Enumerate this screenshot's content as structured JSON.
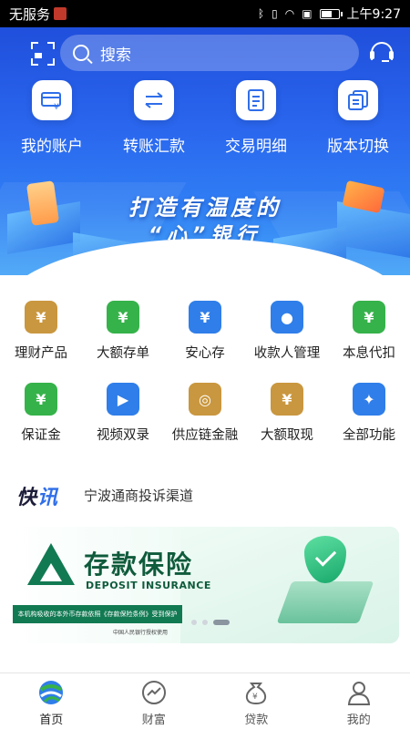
{
  "status_bar": {
    "carrier": "无服务",
    "time": "上午9:27",
    "battery_level": 0.55
  },
  "header": {
    "search_placeholder": "搜索",
    "quick_actions": [
      {
        "label": "我的账户",
        "icon": "account-card-icon"
      },
      {
        "label": "转账汇款",
        "icon": "transfer-arrows-icon"
      },
      {
        "label": "交易明细",
        "icon": "receipt-icon"
      },
      {
        "label": "版本切换",
        "icon": "switch-version-icon"
      }
    ],
    "banner_line1": "打造有温度的",
    "banner_line2": "“心”银行"
  },
  "features": [
    {
      "label": "理财产品",
      "icon": "money-bag-icon",
      "color": "#c9973f",
      "glyph": "¥"
    },
    {
      "label": "大额存单",
      "icon": "deposit-certificate-icon",
      "color": "#36b24a",
      "glyph": "¥"
    },
    {
      "label": "安心存",
      "icon": "safe-deposit-icon",
      "color": "#2f7ee9",
      "glyph": "¥"
    },
    {
      "label": "收款人管理",
      "icon": "payee-contact-icon",
      "color": "#2f7ee9",
      "glyph": "●"
    },
    {
      "label": "本息代扣",
      "icon": "auto-debit-icon",
      "color": "#36b24a",
      "glyph": "¥"
    },
    {
      "label": "保证金",
      "icon": "margin-deposit-icon",
      "color": "#36b24a",
      "glyph": "¥"
    },
    {
      "label": "视频双录",
      "icon": "video-record-icon",
      "color": "#2f7ee9",
      "glyph": "▶"
    },
    {
      "label": "供应链金融",
      "icon": "supply-chain-icon",
      "color": "#c9973f",
      "glyph": "◎"
    },
    {
      "label": "大额取现",
      "icon": "cash-withdraw-icon",
      "color": "#c9973f",
      "glyph": "¥"
    },
    {
      "label": "全部功能",
      "icon": "all-functions-icon",
      "color": "#2f7ee9",
      "glyph": "✦"
    }
  ],
  "news": {
    "title_a": "快",
    "title_b": "讯",
    "item": "宁波通商投诉渠道"
  },
  "promo": {
    "title_cn": "存款保险",
    "title_en": "DEPOSIT INSURANCE",
    "ribbon": "本机构吸收的本外币存款依照《存款保险条例》受到保护",
    "footnote": "中国人民银行授权使用"
  },
  "bottom_nav": [
    {
      "label": "首页",
      "icon": "home-icon",
      "active": true
    },
    {
      "label": "财富",
      "icon": "wealth-icon",
      "active": false
    },
    {
      "label": "贷款",
      "icon": "loan-icon",
      "active": false
    },
    {
      "label": "我的",
      "icon": "profile-icon",
      "active": false
    }
  ]
}
